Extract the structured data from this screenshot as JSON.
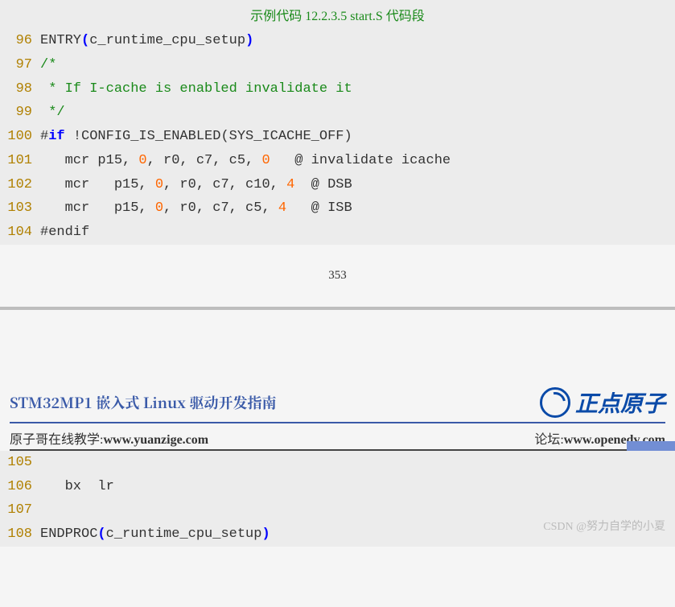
{
  "caption": "示例代码 12.2.3.5 start.S 代码段",
  "code1": {
    "lines": [
      {
        "n": "96",
        "tokens": [
          [
            "ident",
            "ENTRY"
          ],
          [
            "paren",
            "("
          ],
          [
            "ident",
            "c_runtime_cpu_setup"
          ],
          [
            "paren",
            ")"
          ]
        ]
      },
      {
        "n": "97",
        "tokens": [
          [
            "comment",
            "/*"
          ]
        ]
      },
      {
        "n": "98",
        "tokens": [
          [
            "comment",
            " * If I-cache is enabled invalidate it"
          ]
        ]
      },
      {
        "n": "99",
        "tokens": [
          [
            "comment",
            " */"
          ]
        ]
      },
      {
        "n": "100",
        "tokens": [
          [
            "ident",
            "#"
          ],
          [
            "keyword",
            "if "
          ],
          [
            "ident",
            "!CONFIG_IS_ENABLED(SYS_ICACHE_OFF)"
          ]
        ]
      },
      {
        "n": "101",
        "tokens": [
          [
            "instr",
            "   mcr p15, "
          ],
          [
            "number",
            "0"
          ],
          [
            "instr",
            ", r0, c7, c5, "
          ],
          [
            "number",
            "0"
          ],
          [
            "instr",
            "   @ invalidate icache "
          ]
        ]
      },
      {
        "n": "102",
        "tokens": [
          [
            "instr",
            "   mcr   p15, "
          ],
          [
            "number",
            "0"
          ],
          [
            "instr",
            ", r0, c7, c10, "
          ],
          [
            "number",
            "4"
          ],
          [
            "instr",
            "  @ DSB "
          ]
        ]
      },
      {
        "n": "103",
        "tokens": [
          [
            "instr",
            "   mcr   p15, "
          ],
          [
            "number",
            "0"
          ],
          [
            "instr",
            ", r0, c7, c5, "
          ],
          [
            "number",
            "4"
          ],
          [
            "instr",
            "   @ ISB "
          ]
        ]
      },
      {
        "n": "104",
        "tokens": [
          [
            "ident",
            "#endif"
          ]
        ]
      }
    ]
  },
  "page_number": "353",
  "doc_title": "STM32MP1 嵌入式 Linux 驱动开发指南",
  "brand": "正点原子",
  "link_left_label": "原子哥在线教学:",
  "link_left_url": "www.yuanzige.com",
  "link_right_label": "论坛:",
  "link_right_url": "www.openedv.com",
  "code2": {
    "lines": [
      {
        "n": "105",
        "tokens": [
          [
            "instr",
            " "
          ]
        ]
      },
      {
        "n": "106",
        "tokens": [
          [
            "instr",
            "   bx  lr "
          ]
        ]
      },
      {
        "n": "107",
        "tokens": [
          [
            "instr",
            " "
          ]
        ]
      },
      {
        "n": "108",
        "tokens": [
          [
            "ident",
            "ENDPROC"
          ],
          [
            "paren",
            "("
          ],
          [
            "ident",
            "c_runtime_cpu_setup"
          ],
          [
            "paren",
            ")"
          ]
        ]
      }
    ]
  },
  "watermark": "CSDN @努力自学的小夏"
}
